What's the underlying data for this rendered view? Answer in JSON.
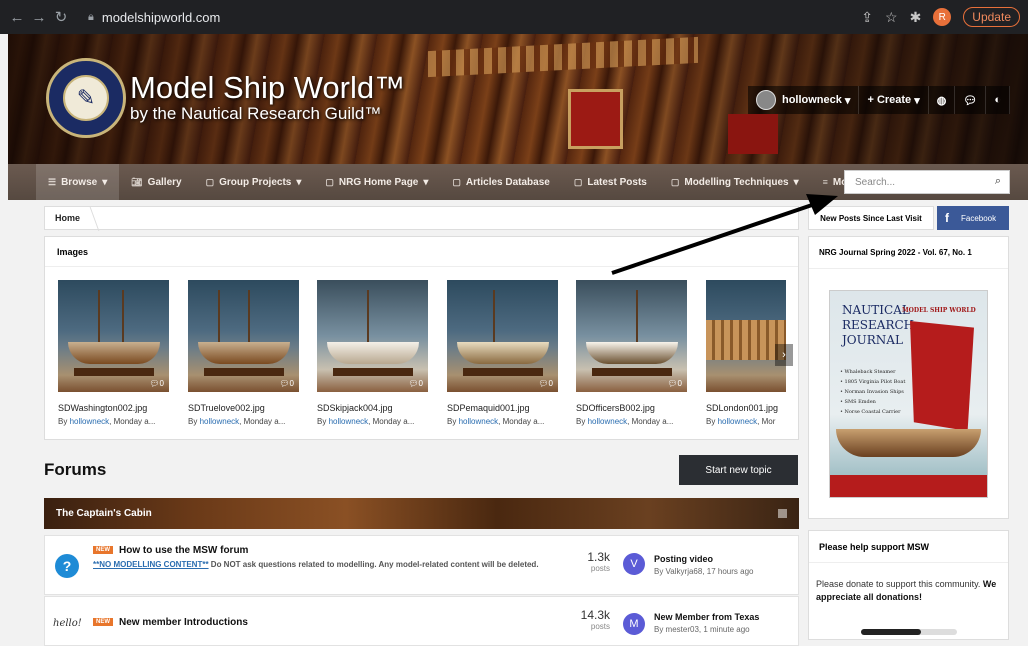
{
  "browser": {
    "url": "modelshipworld.com",
    "profile_initial": "R",
    "update_label": "Update"
  },
  "header": {
    "title": "Model Ship World™",
    "subtitle": "by the Nautical Research Guild™",
    "username": "hollowneck",
    "create_label": "Create"
  },
  "nav": {
    "items": [
      {
        "label": "Browse",
        "icon": "list-icon",
        "dropdown": true
      },
      {
        "label": "Gallery",
        "icon": "camera-icon",
        "dropdown": false
      },
      {
        "label": "Group Projects",
        "icon": "document-icon",
        "dropdown": true
      },
      {
        "label": "NRG Home Page",
        "icon": "document-icon",
        "dropdown": true
      },
      {
        "label": "Articles Database",
        "icon": "document-icon",
        "dropdown": false
      },
      {
        "label": "Latest Posts",
        "icon": "document-icon",
        "dropdown": false
      },
      {
        "label": "Modelling Techniques",
        "icon": "document-icon",
        "dropdown": true
      },
      {
        "label": "More",
        "icon": "menu-icon",
        "dropdown": true
      }
    ],
    "search_placeholder": "Search..."
  },
  "breadcrumb": {
    "home": "Home"
  },
  "newposts_label": "New Posts Since Last Visit",
  "facebook_label": "Facebook",
  "images": {
    "heading": "Images",
    "items": [
      {
        "file": "SDWashington002.jpg",
        "by": "By ",
        "user": "hollowneck",
        "when": ", Monday a...",
        "comments": "0"
      },
      {
        "file": "SDTruelove002.jpg",
        "by": "By ",
        "user": "hollowneck",
        "when": ", Monday a...",
        "comments": "0"
      },
      {
        "file": "SDSkipjack004.jpg",
        "by": "By ",
        "user": "hollowneck",
        "when": ", Monday a...",
        "comments": "0"
      },
      {
        "file": "SDPemaquid001.jpg",
        "by": "By ",
        "user": "hollowneck",
        "when": ", Monday a...",
        "comments": "0"
      },
      {
        "file": "SDOfficersB002.jpg",
        "by": "By ",
        "user": "hollowneck",
        "when": ", Monday a...",
        "comments": "0"
      },
      {
        "file": "SDLondon001.jpg",
        "by": "By ",
        "user": "hollowneck",
        "when": ", Mor",
        "comments": ""
      }
    ]
  },
  "forums": {
    "title": "Forums",
    "start_topic": "Start new topic",
    "category": "The Captain's Cabin",
    "rows": [
      {
        "badge": "NEW",
        "title": "How to use the MSW forum",
        "desc_link": "**NO MODELLING CONTENT**",
        "desc_rest": " Do NOT ask questions related to modelling. Any model-related content will be deleted.",
        "count": "1.3k",
        "count_label": "posts",
        "last_avatar": "V",
        "last_title": "Posting video",
        "last_by": "By Valkyrja68, 17 hours ago"
      },
      {
        "badge": "NEW",
        "icon_text": "hello!",
        "title": "New member Introductions",
        "count": "14.3k",
        "count_label": "posts",
        "last_avatar": "M",
        "last_title": "New Member from Texas",
        "last_by": "By mester03, 1 minute ago"
      }
    ]
  },
  "sidebar": {
    "journal_title": "NRG Journal Spring 2022 - Vol. 67, No. 1",
    "cover": {
      "title_lines": [
        "NAUTICAL",
        "RESEARCH",
        "JOURNAL"
      ],
      "brand": "MODEL SHIP WORLD",
      "bullets": [
        "• Whaleback Steamer",
        "• 1805 Virginia Pilot Boat",
        "• Norman Invasion Ships",
        "• SMS Emden",
        "• Norse Coastal Carrier"
      ]
    },
    "support_title": "Please help support MSW",
    "support_text": "Please donate to support this community.",
    "support_bold": " We appreciate all donations!",
    "donation_progress": 0.62
  }
}
